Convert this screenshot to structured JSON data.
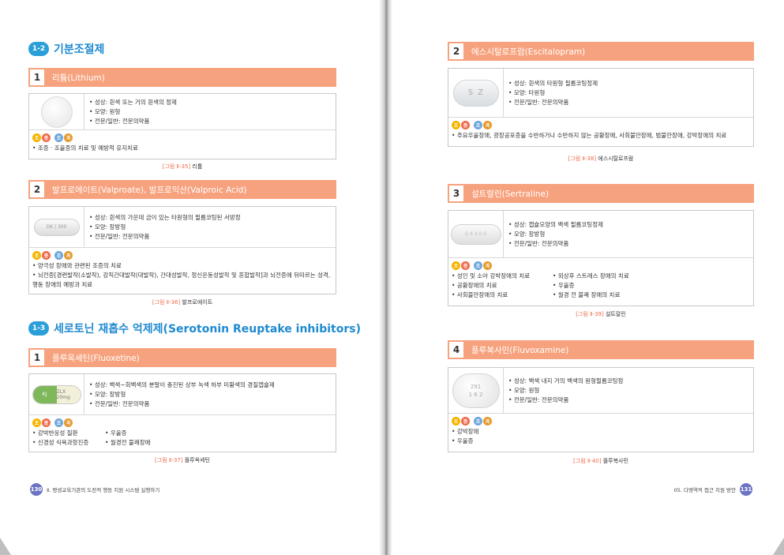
{
  "left": {
    "section1": {
      "badge": "1-2",
      "title": "기분조절제"
    },
    "lithium": {
      "num": "1",
      "title": "리튬(Lithium)",
      "props": [
        "성상: 흰색 또는 거의 흰색의 정제",
        "모양: 원형",
        "전문/일반: 전문의약품"
      ],
      "uses": [
        "조증 · 조울증의 치료 및 예방적 유지치료"
      ],
      "caption_fig": "[그림 Ⅱ-35]",
      "caption_name": "리튬"
    },
    "valproate": {
      "num": "2",
      "title": "발프로에이트(Valproate), 발프로익산(Valproic Acid)",
      "pill_text": "DK | 300",
      "props": [
        "성상: 흰색의 가운데 금이 있는 타원형의 필름코팅된 서방정",
        "모양: 장방형",
        "전문/일반: 전문의약품"
      ],
      "uses": [
        "양극성 장애와 관련된 조증의 치료",
        "뇌전증[경련발작(소발작), 강직간대발작(대발작), 간대성발작, 정신운동성발작 및 혼합발작]과 뇌전증에 뒤따르는 성격, 행동 장애의 예방과 치료"
      ],
      "caption_fig": "[그림 Ⅱ-36]",
      "caption_name": "발프로에이트"
    },
    "section2": {
      "badge": "1-3",
      "title": "세로토닌 재흡수 억제제(Serotonin Reuptake inhibitors)"
    },
    "fluoxetine": {
      "num": "1",
      "title": "플루옥세틴(Fluoxetine)",
      "pill_text_a": "KJ",
      "pill_text_b": "ZLX 20mg",
      "props": [
        "성상: 백색~회백색의 분말이 충진된 상부 녹색 하부 미황색의 경질캡슐제",
        "모양: 장방형",
        "전문/일반: 전문의약품"
      ],
      "uses_col1": [
        "강박반응성 질환",
        "신경성 식욕과항진증"
      ],
      "uses_col2": [
        "우울증",
        "월경전 불쾌장애"
      ],
      "caption_fig": "[그림 Ⅱ-37]",
      "caption_name": "플루옥세틴"
    },
    "footer": {
      "page": "130",
      "text": "Ⅱ. 평생교육기관의 도전적 행동 지원 시스템 실행하기"
    }
  },
  "right": {
    "escitalopram": {
      "num": "2",
      "title": "에스시탈로프람(Escitalopram)",
      "pill_text_a": "S",
      "pill_text_b": "Z",
      "props": [
        "성상: 흰색의 타원형 필름코팅정제",
        "모양: 타원형",
        "전문/일반: 전문의약품"
      ],
      "uses": [
        "주요우울장애, 광장공포증을 수반하거나 수반하지 않는 공황장애, 사회불안장애, 범불안장애, 강박장애의 치료"
      ],
      "caption_fig": "[그림 Ⅱ-38]",
      "caption_name": "에스시탈로프람"
    },
    "sertraline": {
      "num": "3",
      "title": "설트랄린(Sertraline)",
      "pill_text": "G 4 4 0 0",
      "props": [
        "성상: 캡슐모양의 백색 필름코팅정제",
        "모양: 장방형",
        "전문/일반: 전문의약품"
      ],
      "uses_col1": [
        "성인 및 소아 강박장애의 치료",
        "공황장애의 치료",
        "사회불안장애의 치료"
      ],
      "uses_col2": [
        "외상후 스트레스 장애의 치료",
        "우울증",
        "월경 전 불쾌 장애의 치료"
      ],
      "caption_fig": "[그림 Ⅱ-39]",
      "caption_name": "설트랄린"
    },
    "fluvoxamine": {
      "num": "4",
      "title": "플루복사민(Fluvoxamine)",
      "pill_text_a": "291",
      "pill_text_b": "1 6 2",
      "props": [
        "성상: 백색 내지 거의 백색의 원형필름코팅정",
        "모양: 원형",
        "전문/일반: 전문의약품"
      ],
      "uses": [
        "강박장애",
        "우울증"
      ],
      "caption_fig": "[그림 Ⅱ-40]",
      "caption_name": "플루복사민"
    },
    "footer": {
      "page": "131",
      "text": "05. 다영역적 접근 지원 방안"
    }
  },
  "tags": {
    "t1a": "조",
    "t1b": "증",
    "t2a": "조",
    "t2b": "과"
  },
  "colors": {
    "accent_blue": "#2a9fd8",
    "bar_salmon": "#f7a27e",
    "caption_red": "#ef6b4a",
    "page_badge": "#6c74c4"
  }
}
